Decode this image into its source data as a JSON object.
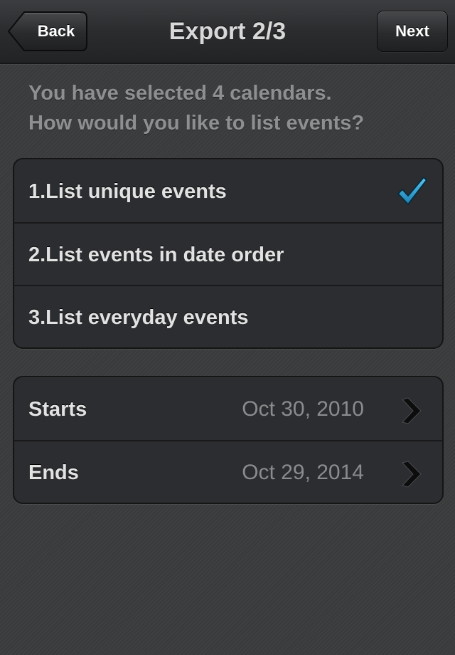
{
  "navbar": {
    "title": "Export 2/3",
    "back_label": "Back",
    "next_label": "Next"
  },
  "prompt": {
    "line1": "You have selected 4 calendars.",
    "line2": "How would you like to list events?"
  },
  "options": [
    {
      "label": "1.List unique events",
      "selected": true
    },
    {
      "label": "2.List events in date order",
      "selected": false
    },
    {
      "label": "3.List everyday events",
      "selected": false
    }
  ],
  "dates": [
    {
      "label": "Starts",
      "value": "Oct 30, 2010"
    },
    {
      "label": "Ends",
      "value": "Oct 29, 2014"
    }
  ],
  "icons": {
    "selected": "checkmark-icon",
    "disclosure": "chevron-right-icon"
  },
  "colors": {
    "checkmark": "#2aa3d6",
    "background": "#3a3b3d",
    "cell": "#2c2d30"
  }
}
